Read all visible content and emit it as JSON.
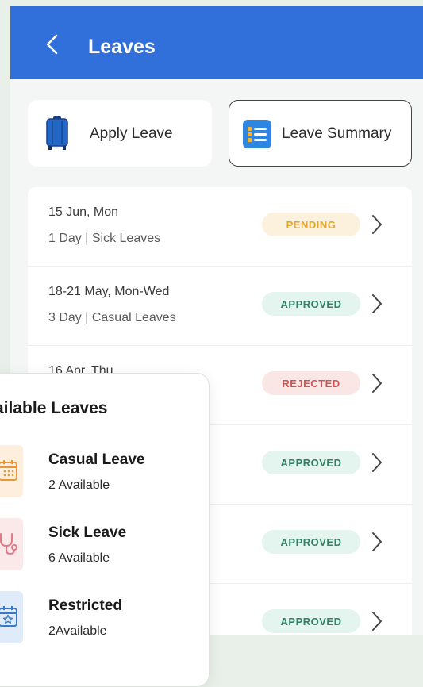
{
  "header": {
    "title": "Leaves"
  },
  "actions": {
    "apply_label": "Apply Leave",
    "summary_label": "Leave Summary"
  },
  "leave_requests": [
    {
      "date": "15 Jun, Mon",
      "detail": "1 Day | Sick Leaves",
      "status": "PENDING"
    },
    {
      "date": "18-21 May, Mon-Wed",
      "detail": "3 Day | Casual Leaves",
      "status": "APPROVED"
    },
    {
      "date": "16 Apr, Thu",
      "detail": "",
      "status": "REJECTED"
    },
    {
      "date": "",
      "detail": "",
      "status": "APPROVED"
    },
    {
      "date": "",
      "detail": "",
      "status": "APPROVED"
    },
    {
      "date": "",
      "detail": "",
      "status": "APPROVED"
    }
  ],
  "available_panel": {
    "title": "ailable Leaves",
    "items": [
      {
        "name": "Casual Leave",
        "available": "2 Available",
        "icon": "calendar-icon",
        "tile_color": "#fdeedd"
      },
      {
        "name": "Sick Leave",
        "available": "6 Available",
        "icon": "stethoscope-icon",
        "tile_color": "#fbe9ea"
      },
      {
        "name": "Restricted",
        "available": "2Available",
        "icon": "calendar-star-icon",
        "tile_color": "#dfebf8"
      }
    ]
  },
  "colors": {
    "header": "#3170db",
    "pending": "#e3a635",
    "approved": "#2f8263",
    "rejected": "#cf5454"
  }
}
